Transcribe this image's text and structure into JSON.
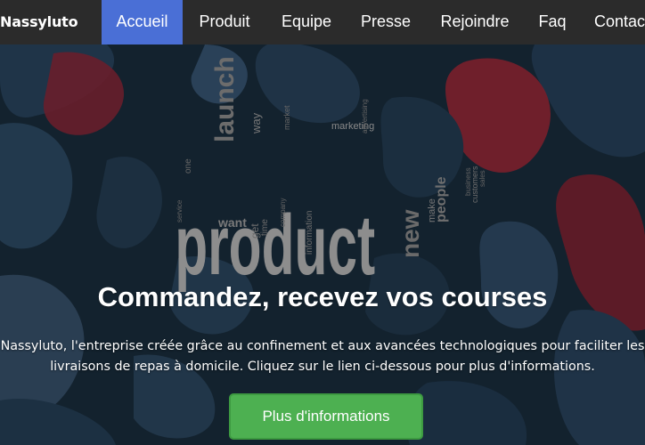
{
  "navbar": {
    "brand": "Nassyluto",
    "items": [
      {
        "label": "Accueil",
        "active": true
      },
      {
        "label": "Produit",
        "active": false
      },
      {
        "label": "Equipe",
        "active": false
      },
      {
        "label": "Presse",
        "active": false
      },
      {
        "label": "Rejoindre",
        "active": false
      },
      {
        "label": "Faq",
        "active": false
      },
      {
        "label": "Contact",
        "active": false
      }
    ]
  },
  "hero": {
    "wordcloud": {
      "main": "product",
      "words": [
        "launch",
        "new",
        "marketing",
        "people",
        "make",
        "want",
        "get",
        "information",
        "way",
        "customers",
        "time",
        "one",
        "advertising",
        "company",
        "business",
        "market",
        "service",
        "sales"
      ]
    },
    "title": "Commandez, recevez vos courses",
    "description_line1": "Nassyluto, l'entreprise créée grâce au confinement et aux avancées technologiques pour faciliter les",
    "description_line2": "livraisons de repas à domicile. Cliquez sur le lien ci-dessous pour plus d'informations.",
    "cta_label": "Plus d'informations"
  },
  "colors": {
    "navbar_bg": "#2b2b2b",
    "nav_active": "#4a6fd6",
    "cta_bg": "#4db051",
    "accent_red": "#7a1f2b",
    "accent_navy": "#1a2d3f"
  }
}
